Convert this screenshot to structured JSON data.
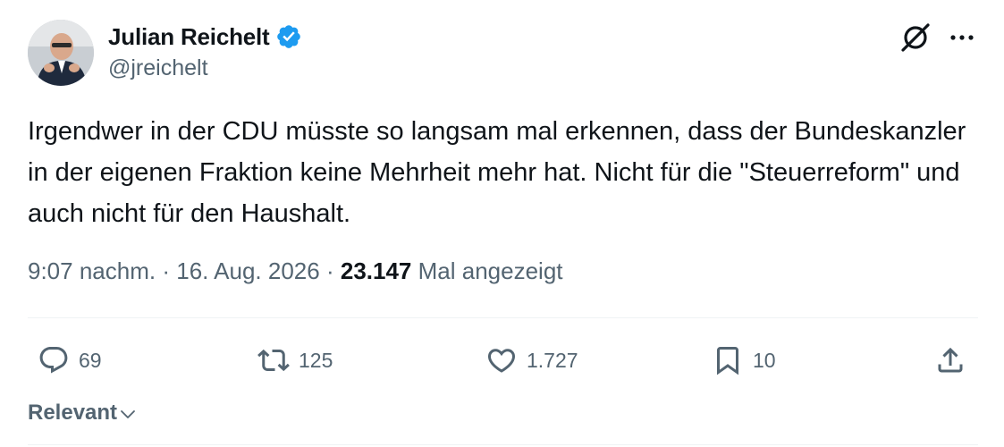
{
  "author": {
    "display_name": "Julian Reichelt",
    "handle": "@jreichelt",
    "verified": true
  },
  "tweet": {
    "text": "Irgendwer in der CDU müsste so langsam mal erkennen, dass der Bundeskanzler in der eigenen Fraktion keine Mehrheit mehr hat. Nicht für die \"Steuerreform\" und auch nicht für den Haushalt.",
    "time": "9:07 nachm.",
    "date": "16. Aug. 2026",
    "separator": "·",
    "views_count": "23.147",
    "views_label": "Mal angezeigt"
  },
  "actions": {
    "replies": "69",
    "reposts": "125",
    "likes": "1.727",
    "bookmarks": "10"
  },
  "sort": {
    "label": "Relevant"
  },
  "icons": {
    "verified": "verified-badge-icon",
    "grok": "grok-icon",
    "more": "more-icon",
    "reply": "reply-icon",
    "retweet": "retweet-icon",
    "like": "heart-icon",
    "bookmark": "bookmark-icon",
    "share": "share-icon",
    "sort": "chevron-down-icon"
  },
  "colors": {
    "text": "#0f1419",
    "secondary": "#536471",
    "verified": "#1d9bf0",
    "divider": "#eff3f4"
  }
}
